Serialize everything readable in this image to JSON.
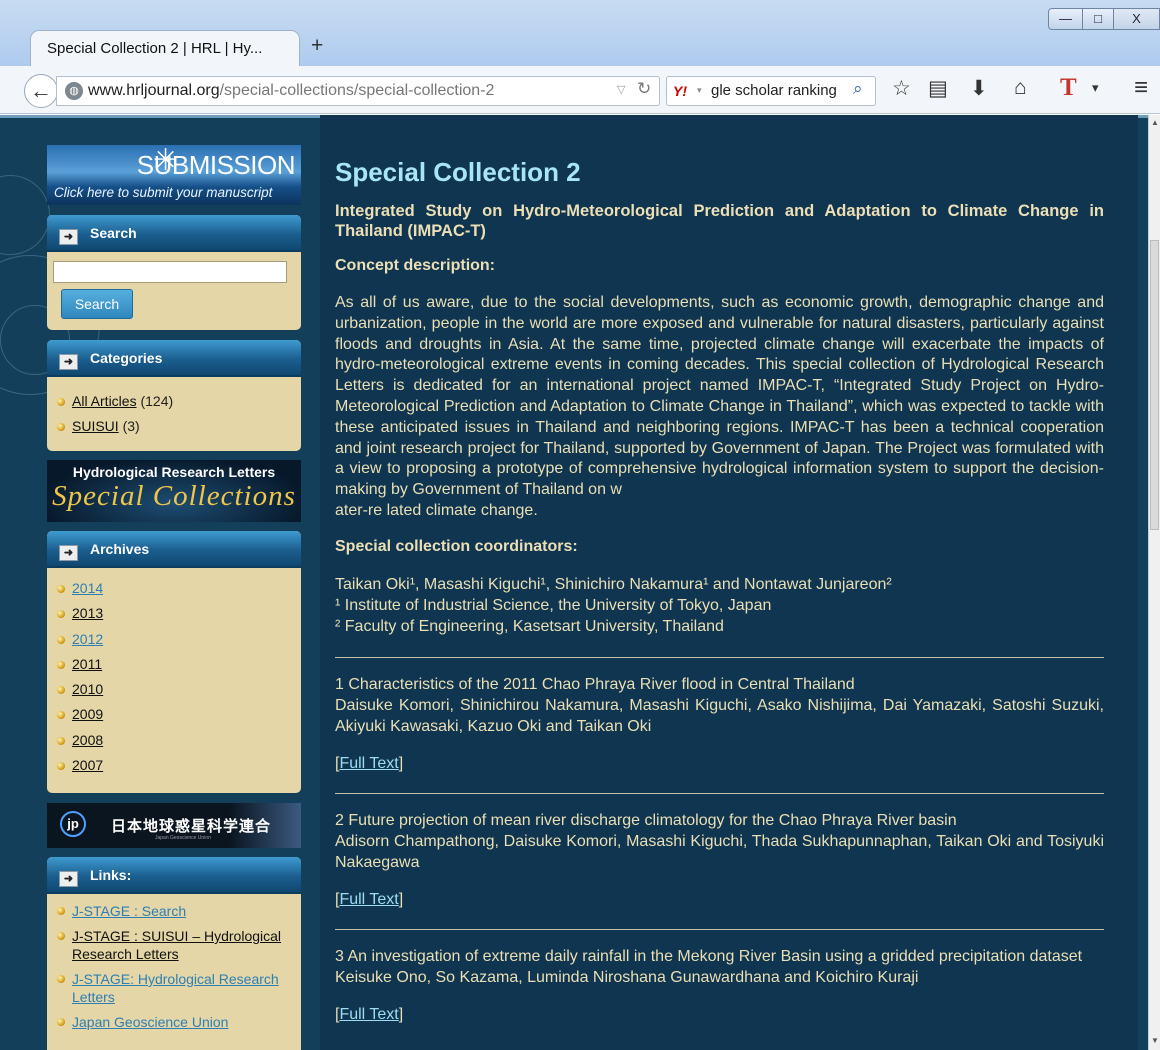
{
  "browser": {
    "tab_title": "Special Collection 2 | HRL | Hy...",
    "new_tab": "+",
    "url_host": "www.hrljournal.org",
    "url_path": "/special-collections/special-collection-2",
    "search_text": "gle scholar ranking",
    "window_buttons": {
      "minimize": "—",
      "maximize": "□",
      "close": "X"
    },
    "icons": [
      "back-icon",
      "globe-icon",
      "dropdown-icon",
      "reload-icon",
      "yahoo-icon",
      "search-icon",
      "star-icon",
      "bookmarks-icon",
      "download-icon",
      "home-icon",
      "t-icon",
      "menu-icon"
    ]
  },
  "sidebar": {
    "submission": {
      "title": "SUBMISSION",
      "subtitle": "Click here to submit your manuscript"
    },
    "search": {
      "title": "Search",
      "button": "Search",
      "value": ""
    },
    "categories": {
      "title": "Categories",
      "items": [
        {
          "label": "All Articles",
          "count": "(124)"
        },
        {
          "label": "SUISUI",
          "count": "(3)"
        }
      ]
    },
    "special_banner": {
      "line1": "Hydrological Research Letters",
      "line2": "Special Collections"
    },
    "archives": {
      "title": "Archives",
      "items": [
        "2014",
        "2013",
        "2012",
        "2011",
        "2010",
        "2009",
        "2008",
        "2007"
      ]
    },
    "jgu": {
      "icon": "jp",
      "title": "日本地球惑星科学連合",
      "sub": "Japan Geoscience Union"
    },
    "links": {
      "title": "Links:",
      "items": [
        "J-STAGE : Search",
        "J-STAGE : SUISUI – Hydrological Research Letters",
        "J-STAGE: Hydrological Research Letters",
        "Japan Geoscience Union"
      ]
    }
  },
  "main": {
    "title": "Special Collection 2",
    "subtitle": "Integrated Study on Hydro-Meteorological Prediction and Adaptation to Climate Change in Thailand (IMPAC-T)",
    "concept_heading": "Concept description:",
    "concept_text": "As all of us aware, due to the social developments, such as economic growth, demographic change and urbanization, people in the world are more exposed and vulnerable for natural disasters, particularly against floods and droughts in Asia. At the same time, projected climate change will exacerbate the impacts of hydro-meteorological extreme events in coming decades. This special collection of Hydrological Research Letters is dedicated for an international project named IMPAC-T, “Integrated Study Project on Hydro-Meteorological Prediction and Adaptation to Climate Change in Thailand”, which was expected to tackle with these anticipated issues in Thailand and neighboring regions. IMPAC-T has been a technical cooperation and joint research project for Thailand, supported by Government of Japan. The Project was formulated with a view to proposing a prototype of comprehensive hydrological information system to support the decision-making by Government of Thailand on w",
    "concept_tail": "ater-re lated climate change.",
    "coord_heading": "Special collection coordinators:",
    "coordinators": [
      "Taikan Oki¹, Masashi Kiguchi¹, Shinichiro Nakamura¹ and Nontawat Junjareon²",
      "¹ Institute of Industrial Science, the University of Tokyo, Japan",
      "² Faculty of Engineering, Kasetsart University, Thailand"
    ],
    "articles": [
      {
        "title": "1 Characteristics of the 2011 Chao Phraya River flood in Central Thailand",
        "authors": "Daisuke Komori, Shinichirou Nakamura, Masashi Kiguchi, Asako Nishijima, Dai Yamazaki, Satoshi Suzuki, Akiyuki Kawasaki, Kazuo Oki and Taikan Oki",
        "link": "Full Text"
      },
      {
        "title": "2 Future projection of mean river discharge climatology for the Chao Phraya River basin",
        "authors": "Adisorn Champathong, Daisuke Komori, Masashi Kiguchi, Thada Sukhapunnaphan, Taikan Oki and Tosiyuki Nakaegawa",
        "link": "Full Text"
      },
      {
        "title": "3 An investigation of extreme daily rainfall in the Mekong River Basin using a gridded precipitation dataset",
        "authors": "Keisuke Ono, So Kazama, Luminda Niroshana Gunawardhana and Koichiro Kuraji",
        "link": "Full Text"
      }
    ]
  }
}
